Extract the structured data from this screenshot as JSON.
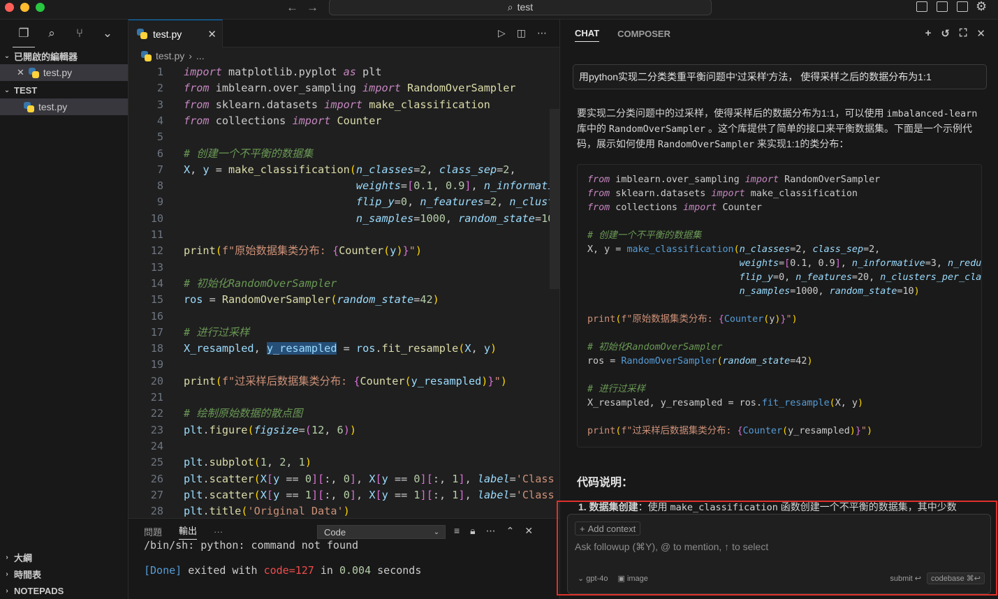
{
  "titlebar": {
    "search_text": "test"
  },
  "sidebar": {
    "open_editors_title": "已開啟的編輯器",
    "open_editor_file": "test.py",
    "folder_title": "TEST",
    "folder_file": "test.py",
    "bottom_sections": [
      "大綱",
      "時間表",
      "NOTEPADS"
    ]
  },
  "editor": {
    "tab_label": "test.py",
    "breadcrumb_file": "test.py",
    "breadcrumb_more": "...",
    "line_numbers": [
      "1",
      "2",
      "3",
      "4",
      "5",
      "6",
      "7",
      "8",
      "9",
      "10",
      "11",
      "12",
      "13",
      "14",
      "15",
      "16",
      "17",
      "18",
      "19",
      "20",
      "21",
      "22",
      "23",
      "24",
      "25",
      "26",
      "27",
      "28"
    ]
  },
  "panel": {
    "tab_problems": "問題",
    "tab_output": "輸出",
    "more": "···",
    "select_value": "Code",
    "output_line1": "/bin/sh: python: command not found",
    "done_tag": "[Done]",
    "exited_with": " exited with ",
    "code_value": "code=127",
    "in_text": " in ",
    "duration": "0.004",
    "seconds": " seconds"
  },
  "chat": {
    "tab_chat": "CHAT",
    "tab_composer": "COMPOSER",
    "user_message": "用python实现二分类类重平衡问题中'过采样'方法， 使得采样之后的数据分布为1:1",
    "answer_part1": "要实现二分类问题中的过采样，使得采样后的数据分布为1:1，可以使用 ",
    "answer_code1": "imbalanced-learn",
    "answer_part2": " 库中的 ",
    "answer_code2": "RandomOverSampler",
    "answer_part3": " 。这个库提供了简单的接口来平衡数据集。下面是一个示例代码，展示如何使用 ",
    "answer_code3": "RandomOverSampler",
    "answer_part4": " 来实现1:1的类分布：",
    "section_heading": "代码说明：",
    "list_item_bold": "1. 数据集创建",
    "list_item_text": "：使用 ",
    "list_item_code": "make_classification",
    "list_item_rest": " 函数创建一个不平衡的数据集，其中少数",
    "add_context": "Add context",
    "followup_placeholder": "Ask followup (⌘Y), @ to mention, ↑ to select",
    "model": "gpt-4o",
    "image_btn": "image",
    "submit": "submit ↩",
    "codebase": "codebase ⌘↩"
  }
}
